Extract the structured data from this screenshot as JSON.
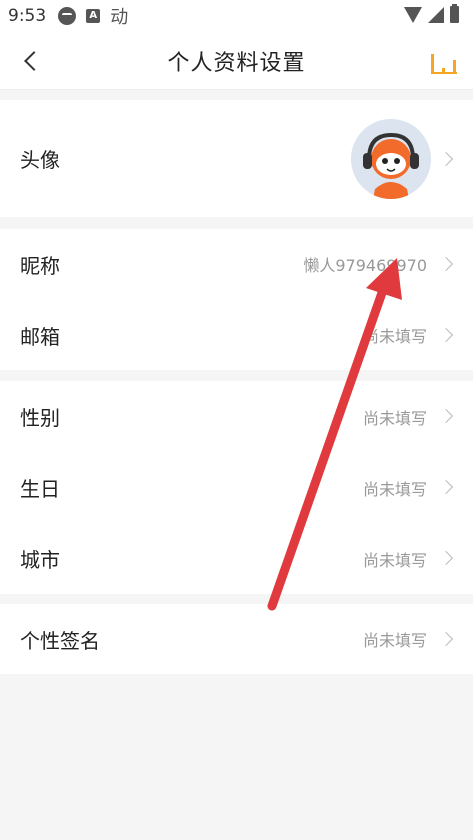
{
  "status_bar": {
    "time": "9:53",
    "notification_dong": "动"
  },
  "nav": {
    "title": "个人资料设置",
    "back_icon": "back-chevron-icon",
    "level_icon": "level-bars-icon"
  },
  "rows": {
    "avatar": {
      "label": "头像"
    },
    "nickname": {
      "label": "昵称",
      "value": "懒人979469970"
    },
    "email": {
      "label": "邮箱",
      "value": "尚未填写"
    },
    "gender": {
      "label": "性别",
      "value": "尚未填写"
    },
    "birthday": {
      "label": "生日",
      "value": "尚未填写"
    },
    "city": {
      "label": "城市",
      "value": "尚未填写"
    },
    "signature": {
      "label": "个性签名",
      "value": "尚未填写"
    }
  },
  "colors": {
    "accent": "#f5a623",
    "annotation_arrow": "#e03a3e",
    "value_text": "#999999",
    "background": "#f5f5f5"
  }
}
